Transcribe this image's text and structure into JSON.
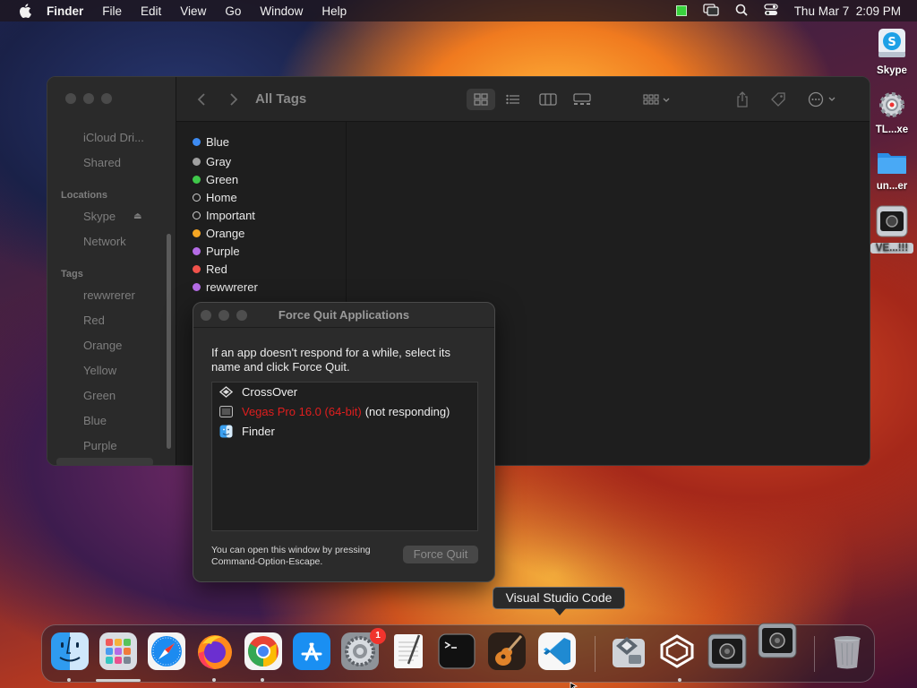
{
  "menubar": {
    "app_name": "Finder",
    "menus": [
      "File",
      "Edit",
      "View",
      "Go",
      "Window",
      "Help"
    ],
    "datetime": "Thu Mar 7  2:09 PM",
    "status_icons": [
      "screen-recording-indicator",
      "screen-mirroring-icon",
      "search-icon",
      "control-center-icon"
    ]
  },
  "desktop_icons": [
    {
      "label": "Skype",
      "icon": "skype-drive-icon"
    },
    {
      "label": "TL...xe",
      "icon": "gear-app-icon"
    },
    {
      "label": "un...er",
      "icon": "folder-icon"
    },
    {
      "label": "VE...!!!",
      "icon": "video-app-icon"
    }
  ],
  "finder": {
    "title": "All Tags",
    "sidebar": {
      "items_top": [
        "iCloud Dri...",
        "Shared"
      ],
      "locations_header": "Locations",
      "locations": [
        "Skype",
        "Network"
      ],
      "tags_header": "Tags",
      "tags": [
        "rewwrerer",
        "Red",
        "Orange",
        "Yellow",
        "Green",
        "Blue",
        "Purple"
      ]
    },
    "tags_list": [
      {
        "name": "Blue",
        "color": "#3d8bf2",
        "hollow": false
      },
      {
        "name": "Gray",
        "color": "#a0a0a0",
        "hollow": false
      },
      {
        "name": "Green",
        "color": "#3fc84a",
        "hollow": false
      },
      {
        "name": "Home",
        "color": "",
        "hollow": true
      },
      {
        "name": "Important",
        "color": "",
        "hollow": true
      },
      {
        "name": "Orange",
        "color": "#f5a623",
        "hollow": false
      },
      {
        "name": "Purple",
        "color": "#b56ce6",
        "hollow": false
      },
      {
        "name": "Red",
        "color": "#f0524b",
        "hollow": false
      },
      {
        "name": "rewwrerer",
        "color": "#b56ce6",
        "hollow": false
      }
    ]
  },
  "force_quit": {
    "title": "Force Quit Applications",
    "message": "If an app doesn't respond for a while, select its name and click Force Quit.",
    "apps": [
      {
        "name": "CrossOver",
        "status": "",
        "icon": "crossover-icon",
        "not_responding": false
      },
      {
        "name": "Vegas Pro 16.0 (64-bit)",
        "status": "(not responding)",
        "icon": "vegas-icon",
        "not_responding": true
      },
      {
        "name": "Finder",
        "status": "",
        "icon": "finder-icon",
        "not_responding": false
      }
    ],
    "hint": "You can open this window by pressing Command-Option-Escape.",
    "button": "Force Quit"
  },
  "tooltip": "Visual Studio Code",
  "dock": {
    "items": [
      "Finder",
      "Launchpad",
      "Safari",
      "Firefox",
      "Chrome",
      "App Store",
      "System Settings",
      "TextEdit",
      "Terminal",
      "GarageBand",
      "Visual Studio Code",
      "CrossOver",
      "Unity Hub",
      "Vegas Pro",
      "Vegas Pro 2",
      "Trash"
    ],
    "settings_badge": "1"
  }
}
